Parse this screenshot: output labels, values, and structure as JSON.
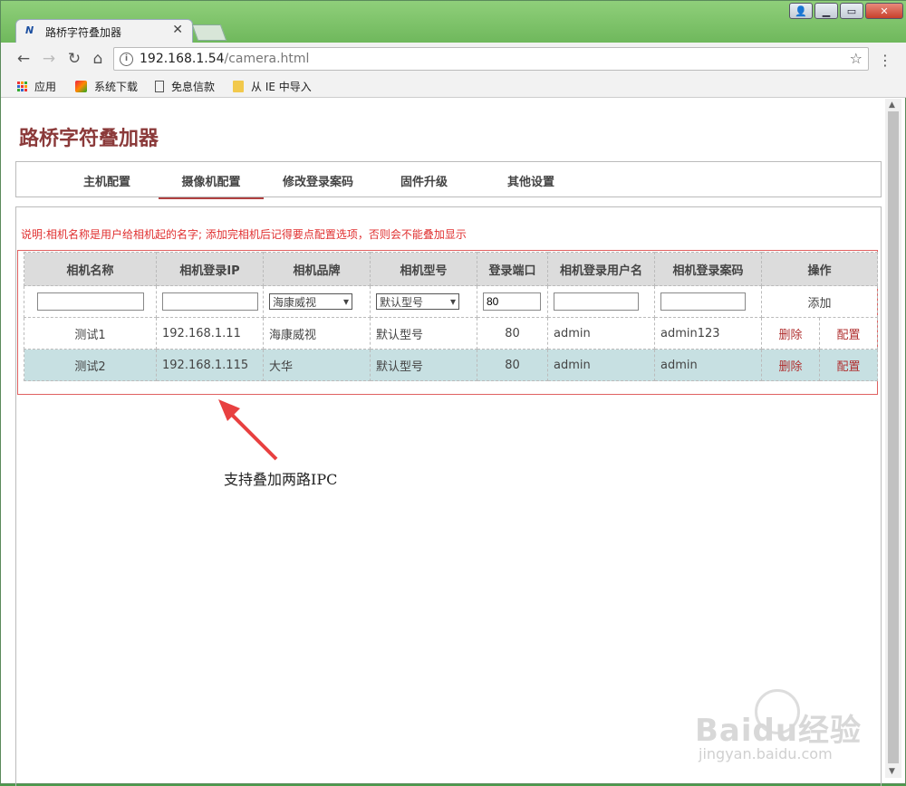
{
  "browser": {
    "tab_title": "路桥字符叠加器",
    "tab_favicon": "N",
    "url_host": "192.168.1.54",
    "url_path": "/camera.html",
    "bookmarks": [
      {
        "label": "应用",
        "icon": "apps-icon"
      },
      {
        "label": "系统下载",
        "icon": "system-download-icon"
      },
      {
        "label": "免息信款",
        "icon": "page-icon"
      },
      {
        "label": "从 IE 中导入",
        "icon": "folder-icon"
      }
    ]
  },
  "page": {
    "title": "路桥字符叠加器",
    "nav": [
      "主机配置",
      "摄像机配置",
      "修改登录案码",
      "固件升级",
      "其他设置"
    ],
    "active_nav_index": 1,
    "note": "说明:相机名称是用户给相机起的名字; 添加完相机后记得要点配置选项，否则会不能叠加显示",
    "table": {
      "headers": [
        "相机名称",
        "相机登录IP",
        "相机品牌",
        "相机型号",
        "登录端口",
        "相机登录用户名",
        "相机登录案码",
        "操作"
      ],
      "new_row": {
        "brand": "海康威视",
        "model": "默认型号",
        "port": "80",
        "add_label": "添加"
      },
      "rows": [
        {
          "name": "测试1",
          "ip": "192.168.1.11",
          "brand": "海康威视",
          "model": "默认型号",
          "port": "80",
          "user": "admin",
          "password": "admin123",
          "delete": "删除",
          "config": "配置"
        },
        {
          "name": "测试2",
          "ip": "192.168.1.115",
          "brand": "大华",
          "model": "默认型号",
          "port": "80",
          "user": "admin",
          "password": "admin",
          "delete": "删除",
          "config": "配置"
        }
      ]
    }
  },
  "annotation": {
    "caption": "支持叠加两路IPC",
    "arrow_color": "#e84040"
  },
  "watermark": {
    "brand": "Baidu经验",
    "url": "jingyan.baidu.com"
  },
  "colors": {
    "title": "#8b3a3a",
    "note": "#e03030",
    "frame": "#e06060",
    "selected_row": "#c7e0e2",
    "link": "#b03030"
  }
}
